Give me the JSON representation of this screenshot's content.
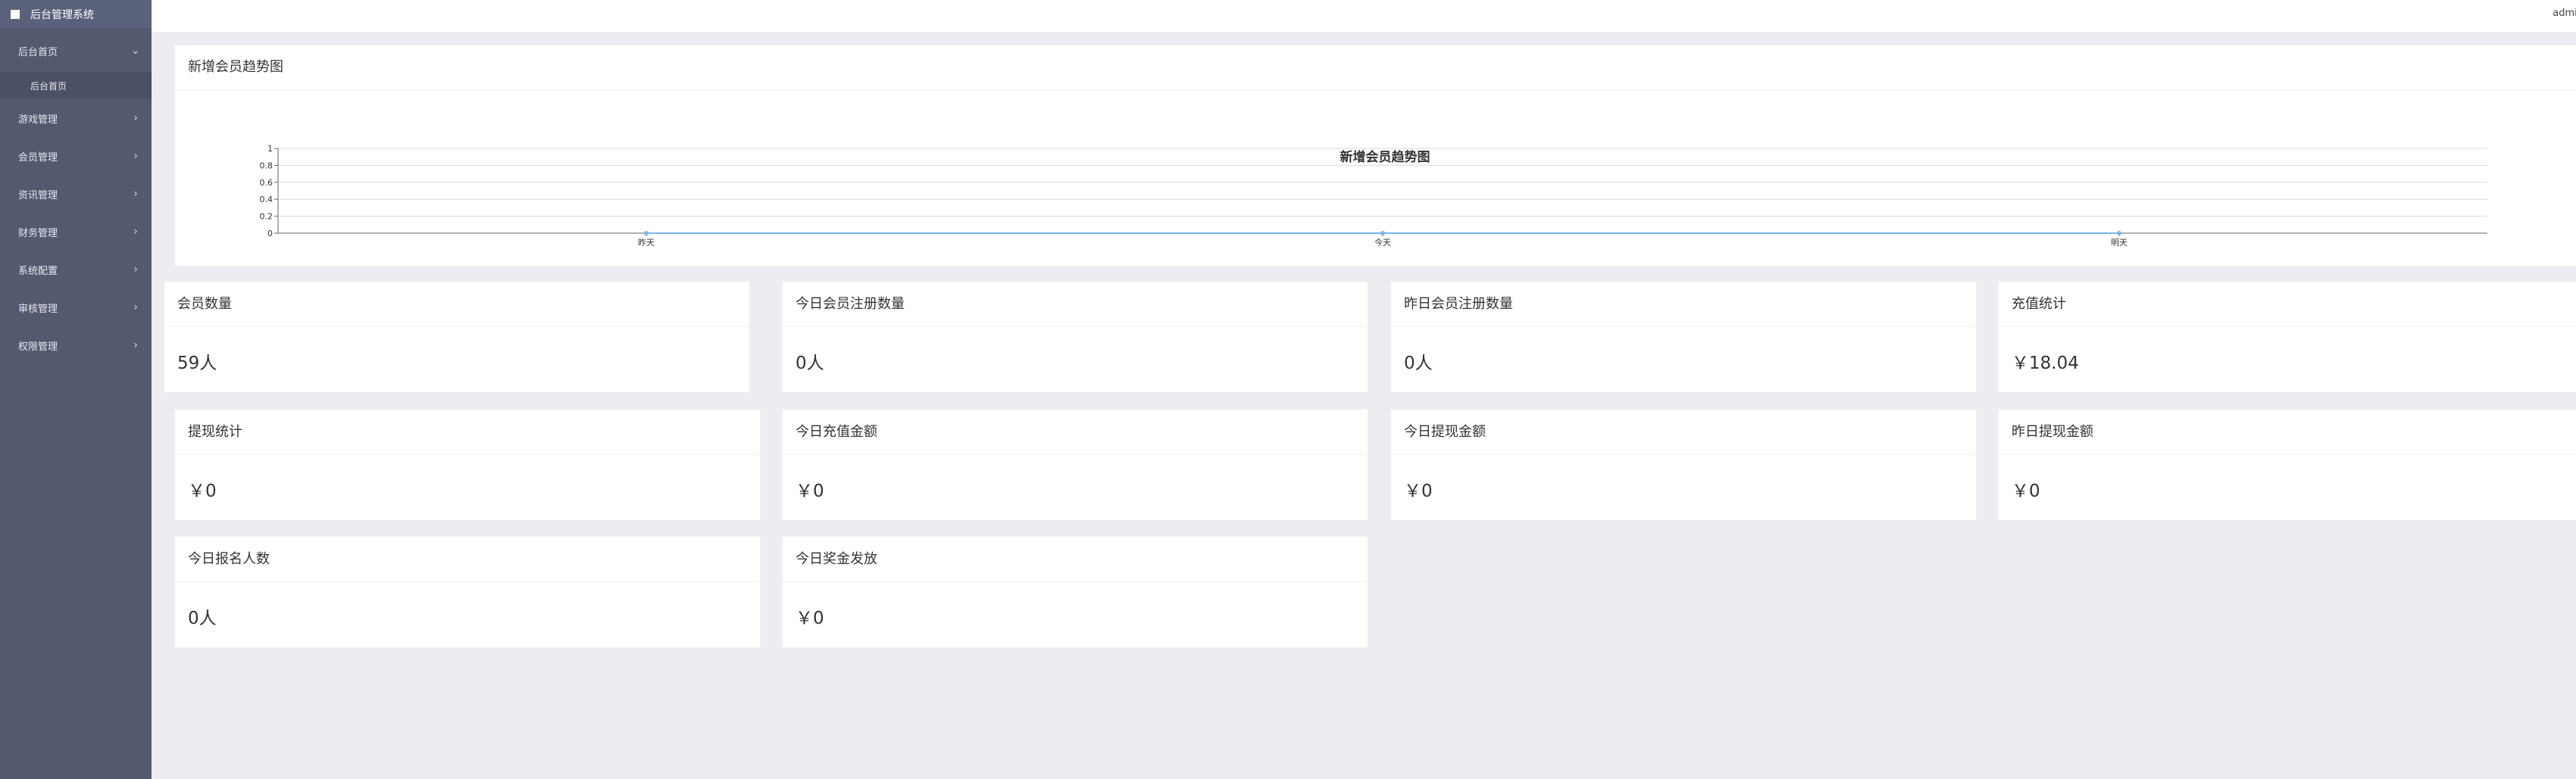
{
  "app": {
    "title": "后台管理系统"
  },
  "sidebar": {
    "items": [
      {
        "label": "后台首页",
        "open": true,
        "children": [
          {
            "label": "后台首页"
          }
        ]
      },
      {
        "label": "游戏管理"
      },
      {
        "label": "会员管理"
      },
      {
        "label": "资讯管理"
      },
      {
        "label": "财务管理"
      },
      {
        "label": "系统配置"
      },
      {
        "label": "审核管理"
      },
      {
        "label": "权限管理"
      }
    ]
  },
  "header": {
    "user": "admin"
  },
  "trend": {
    "card_title": "新增会员趋势图",
    "chart_data": {
      "type": "line",
      "title": "新增会员趋势图",
      "categories": [
        "昨天",
        "今天",
        "明天"
      ],
      "series": [
        {
          "values": [
            0,
            0,
            0
          ]
        }
      ],
      "ylim": [
        0,
        1
      ],
      "yticks": [
        "0",
        "0.2",
        "0.4",
        "0.6",
        "0.8",
        "1"
      ],
      "grid": true
    }
  },
  "stats": [
    {
      "title": "会员数量",
      "value": "59人"
    },
    {
      "title": "今日会员注册数量",
      "value": "0人"
    },
    {
      "title": "昨日会员注册数量",
      "value": "0人"
    },
    {
      "title": "充值统计",
      "value": "￥18.04"
    },
    {
      "title": "提现统计",
      "value": "￥0"
    },
    {
      "title": "今日充值金额",
      "value": "￥0"
    },
    {
      "title": "今日提现金额",
      "value": "￥0"
    },
    {
      "title": "昨日提现金额",
      "value": "￥0"
    },
    {
      "title": "今日报名人数",
      "value": "0人"
    },
    {
      "title": "今日奖金发放",
      "value": "￥0"
    }
  ],
  "colors": {
    "sidebar": "#535a70",
    "sidebar_active": "#4a5065",
    "background": "#ebedf0"
  }
}
